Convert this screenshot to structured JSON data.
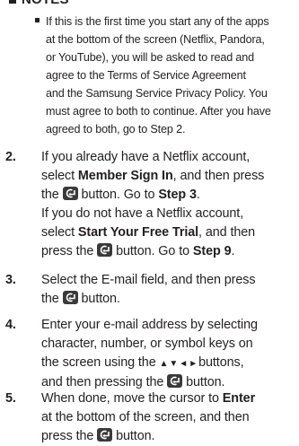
{
  "notes_title": "NOTES",
  "bullet": {
    "lines": [
      "If this is the first time you start any of the apps",
      "at the bottom of the screen (Netflix, Pandora,",
      "or YouTube), you will be asked to read and",
      "agree to the Terms of Service Agreement",
      "and the Samsung Service Privacy Policy. You",
      "must agree to both to continue. After you have",
      "agreed to both, go to Step 2."
    ]
  },
  "steps": [
    {
      "num": "2.",
      "l1": "If you already have a Netflix account,",
      "l2a": "select ",
      "l2b": "Member Sign In",
      "l2c": ", and then press",
      "l3a": "the ",
      "l3b": " button. Go to ",
      "l3c": "Step 3",
      "l3d": ".",
      "l4": "If you do not have a Netflix account,",
      "l5a": "select ",
      "l5b": "Start Your Free Trial",
      "l5c": ", and then",
      "l6a": "press the ",
      "l6b": " button. Go to ",
      "l6c": "Step 9",
      "l6d": "."
    },
    {
      "num": "3.",
      "l1": "Select the E-mail field, and then press",
      "l2a": "the ",
      "l2b": " button."
    },
    {
      "num": "4.",
      "l1": "Enter your e-mail address by selecting",
      "l2": "character, number, or symbol keys on",
      "l3a": "the screen using the ",
      "l3arrows": "▲▼◄►",
      "l3b": "buttons,",
      "l4a": "and then pressing the ",
      "l4b": " button."
    },
    {
      "num": "5.",
      "l1a": "When done, move the cursor to ",
      "l1b": "Enter",
      "l2": "at the bottom of the screen, and then",
      "l3a": "press the ",
      "l3b": " button."
    }
  ]
}
